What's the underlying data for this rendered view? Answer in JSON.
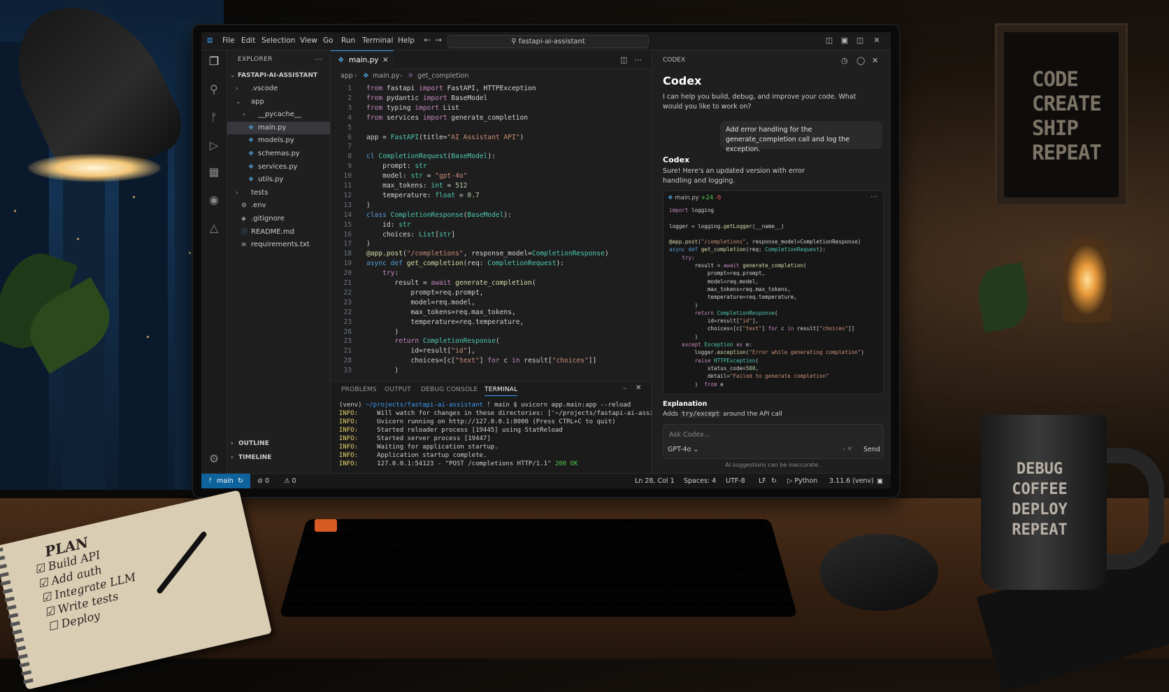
{
  "scene": {
    "poster_lines": [
      "CODE",
      "CREATE",
      "SHIP",
      "REPEAT"
    ],
    "mug_lines": [
      "DEBUG",
      "COFFEE",
      "DEPLOY",
      "REPEAT"
    ],
    "notebook": {
      "title": "PLAN",
      "items": [
        {
          "text": "Build API",
          "checked": true
        },
        {
          "text": "Add auth",
          "checked": true
        },
        {
          "text": "Integrate LLM",
          "checked": true
        },
        {
          "text": "Write tests",
          "checked": true
        },
        {
          "text": "Deploy",
          "checked": false
        }
      ]
    }
  },
  "titlebar": {
    "menu": [
      "File",
      "Edit",
      "Selection",
      "View",
      "Go",
      "Run",
      "Terminal",
      "Help"
    ],
    "search": "fastapi-ai-assistant"
  },
  "explorer": {
    "header": "EXPLORER",
    "root": "FASTAPI-AI-ASSISTANT",
    "items": [
      {
        "label": ".vscode",
        "kind": "folder",
        "depth": 1,
        "open": false
      },
      {
        "label": "app",
        "kind": "folder",
        "depth": 1,
        "open": true
      },
      {
        "label": "__pycache__",
        "kind": "folder",
        "depth": 2,
        "open": false
      },
      {
        "label": "main.py",
        "kind": "py",
        "depth": 2,
        "selected": true
      },
      {
        "label": "models.py",
        "kind": "py",
        "depth": 2
      },
      {
        "label": "schemas.py",
        "kind": "py",
        "depth": 2
      },
      {
        "label": "services.py",
        "kind": "py",
        "depth": 2
      },
      {
        "label": "utils.py",
        "kind": "py",
        "depth": 2
      },
      {
        "label": "tests",
        "kind": "folder",
        "depth": 1,
        "open": false
      },
      {
        "label": ".env",
        "kind": "env",
        "depth": 1
      },
      {
        "label": ".gitignore",
        "kind": "git",
        "depth": 1
      },
      {
        "label": "README.md",
        "kind": "md",
        "depth": 1
      },
      {
        "label": "requirements.txt",
        "kind": "txt",
        "depth": 1
      }
    ],
    "outline": "OUTLINE",
    "timeline": "TIMELINE"
  },
  "editor": {
    "tab": "main.py",
    "breadcrumb": [
      "app",
      "main.py",
      "get_completion"
    ],
    "lines": [
      {
        "n": "1",
        "html": "<span class='kw'>from</span> fastapi <span class='kw'>import</span> FastAPI, HTTPException"
      },
      {
        "n": "2",
        "html": "<span class='kw'>from</span> pydantic <span class='kw'>import</span> BaseModel"
      },
      {
        "n": "3",
        "html": "<span class='kw'>from</span> typing <span class='kw'>import</span> List"
      },
      {
        "n": "4",
        "html": "<span class='kw'>from</span> services <span class='kw'>import</span> generate_completion"
      },
      {
        "n": "5",
        "html": ""
      },
      {
        "n": "6",
        "html": "app = <span class='cls'>FastAPI</span>(title=<span class='st'>\"AI Assistant API\"</span>)"
      },
      {
        "n": "7",
        "html": ""
      },
      {
        "n": "8",
        "html": "<span class='kb'>cl</span> <span class='cls'>CompletionRequest</span>(<span class='cls'>BaseModel</span>):"
      },
      {
        "n": "9",
        "html": "    prompt: <span class='cls'>str</span>"
      },
      {
        "n": "10",
        "html": "    model: <span class='cls'>str</span> = <span class='st'>\"gpt-4o\"</span>"
      },
      {
        "n": "11",
        "html": "    max_tokens: <span class='cls'>int</span> = <span class='nm'>512</span>"
      },
      {
        "n": "12",
        "html": "    temperature: <span class='cls'>float</span> = <span class='nm'>0.7</span>"
      },
      {
        "n": "13",
        "html": ")"
      },
      {
        "n": "14",
        "html": "<span class='kb'>class</span> <span class='cls'>CompletionResponse</span>(<span class='cls'>BaseModel</span>):"
      },
      {
        "n": "15",
        "html": "    id: <span class='cls'>str</span>"
      },
      {
        "n": "16",
        "html": "    choices: <span class='cls'>List</span>[<span class='cls'>str</span>]"
      },
      {
        "n": "17",
        "html": ")"
      },
      {
        "n": "18",
        "html": "<span class='dec'>@app.post</span>(<span class='st'>\"/completions\"</span>, response_model=<span class='cls'>CompletionResponse</span>)"
      },
      {
        "n": "19",
        "html": "<span class='kb'>async def</span> <span class='fn'>get_completion</span>(req: <span class='cls'>CompletionRequest</span>):"
      },
      {
        "n": "20",
        "html": "    <span class='kw'>try</span>:"
      },
      {
        "n": "21",
        "html": "       result = <span class='kw'>await</span> <span class='fn'>generate_completion</span>("
      },
      {
        "n": "22",
        "html": "           prompt=req.prompt,"
      },
      {
        "n": "23",
        "html": "           model=req.model,"
      },
      {
        "n": "22",
        "html": "           max_tokens=req.max_tokens,"
      },
      {
        "n": "23",
        "html": "           temperature=req.temperature,"
      },
      {
        "n": "26",
        "html": "       )"
      },
      {
        "n": "23",
        "html": "       <span class='kw'>return</span> <span class='cls'>CompletionResponse</span>("
      },
      {
        "n": "21",
        "html": "           id=result[<span class='st'>\"id\"</span>],"
      },
      {
        "n": "28",
        "html": "           choices=[c[<span class='st'>\"text\"</span>] <span class='kw'>for</span> c <span class='kw'>in</span> result[<span class='st'>\"choices\"</span>]]"
      },
      {
        "n": "33",
        "html": "       )"
      }
    ]
  },
  "panel": {
    "tabs": [
      "PROBLEMS",
      "OUTPUT",
      "DEBUG CONSOLE",
      "TERMINAL"
    ],
    "active_tab": "TERMINAL",
    "terminal": [
      "<span>(venv)</span> <span class='path'>~/projects/fastapi-ai-assistant</span> ᚠ main $ uvicorn app.main:app --reload",
      "<span class='info'>INFO:</span>     Will watch for changes in these directories: ['~/projects/fastapi-ai-assistant']",
      "<span class='info'>INFO:</span>     Uvicorn running on http://127.0.0.1:8000 (Press CTRL+C to quit)",
      "<span class='info'>INFO:</span>     Started reloader process [19445] using StatReload",
      "<span class='info'>INFO:</span>     Started server process [19447]",
      "<span class='info'>INFO:</span>     Waiting for application startup.",
      "<span class='info'>INFO:</span>     Application startup complete.",
      "<span class='info'>INFO:</span>     127.0.0.1:54123 - \"POST /completions HTTP/1.1\" <span class='ok'>200 OK</span>"
    ]
  },
  "codex": {
    "header": "CODEX",
    "title": "Codex",
    "intro": "I can help you build, debug, and improve your code. What would you like to work on?",
    "user_message": "Add error handling for the generate_completion call and log the exception.",
    "assistant_name": "Codex",
    "assistant_reply": "Sure! Here's an updated version with error handling and logging.",
    "snippet_file": "main.py",
    "snippet_added": "+24",
    "snippet_removed": "-6",
    "snippet_lines": [
      "<span class='kw'>import</span> logging",
      "",
      "logger = logging.<span class='fn'>getLogger</span>(__name__)",
      "",
      "<span class='dec'>@app.post</span>(<span class='st'>\"/completions\"</span>, response_model=CompletionResponse)",
      "<span class='kb'>async def</span> <span class='fn'>get_completion</span>(req: <span class='cls'>CompletionRequest</span>):",
      "    <span class='kw'>try</span>:",
      "        result = <span class='kw'>await</span> <span class='fn'>generate_completion</span>(",
      "            prompt=req.prompt,",
      "            model=req.model,",
      "            max_tokens=req.max_tokens,",
      "            temperature=req.temperature,",
      "        )",
      "        <span class='kw'>return</span> <span class='cls'>CompletionResponse</span>(",
      "            id=result[<span class='st'>\"id\"</span>],",
      "            choices=[c[<span class='st'>\"text\"</span>] <span class='kw'>for</span> c <span class='kw'>in</span> result[<span class='st'>\"choices\"</span>]]",
      "        )",
      "    <span class='kw'>except</span> <span class='cls'>Exception</span> <span class='kw'>as</span> e:",
      "        logger.<span class='fn'>exception</span>(<span class='st'>\"Error while generating completion\"</span>)",
      "        <span class='kw'>raise</span> <span class='cls'>HTTPException</span>(",
      "            status_code=<span class='nm'>500</span>,",
      "            detail=<span class='st'>\"Failed to generate completion\"</span>",
      "        )  <span class='kw'>from</span> e"
    ],
    "explanation_title": "Explanation",
    "explanation_pre": "Adds ",
    "explanation_code": "try/except",
    "explanation_post": " around the API call",
    "ask_placeholder": "Ask Codex...",
    "model": "GPT-4o",
    "send": "Send",
    "disclaimer": "AI suggestions can be inaccurate."
  },
  "statusbar": {
    "branch": "main",
    "errors": "0",
    "warnings": "0",
    "cursor": "Ln 28, Col 1",
    "spaces": "Spaces: 4",
    "encoding": "UTF-8",
    "eol": "LF",
    "language": "Python",
    "interpreter": "3.11.6 (venv)"
  },
  "colors": {
    "accent": "#3b9dfa",
    "status_branch": "#0e639c",
    "terminal_ok": "#4ec94e"
  }
}
